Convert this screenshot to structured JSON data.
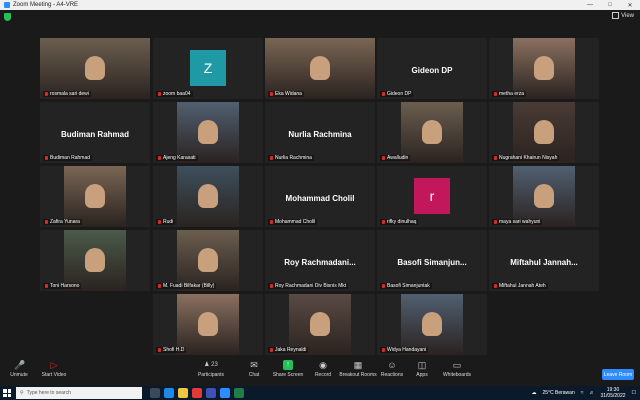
{
  "window": {
    "title": "Zoom Meeting - A4-VRE",
    "view_label": "View"
  },
  "participants": [
    {
      "name": "rosmala sari dewi",
      "kind": "video",
      "active": true
    },
    {
      "name": "zoom baa04",
      "kind": "letter",
      "letter": "Z",
      "color": "#1f9aa5"
    },
    {
      "name": "Eka Widana",
      "kind": "video"
    },
    {
      "name": "Gideon DP",
      "kind": "label",
      "big": "Gideon DP"
    },
    {
      "name": "metha erza",
      "kind": "video"
    },
    {
      "name": "Budiman Rahmad",
      "kind": "label",
      "big": "Budiman Rahmad"
    },
    {
      "name": "Ajeng Karasati",
      "kind": "video"
    },
    {
      "name": "Nurlia Rachmina",
      "kind": "label",
      "big": "Nurlia Rachmina"
    },
    {
      "name": "Awalludin",
      "kind": "video"
    },
    {
      "name": "Nugrahani Khairun Nisyah",
      "kind": "video"
    },
    {
      "name": "Zafira Yunara",
      "kind": "video"
    },
    {
      "name": "Rudi",
      "kind": "video"
    },
    {
      "name": "Mohammad Cholil",
      "kind": "label",
      "big": "Mohammad Cholil"
    },
    {
      "name": "rifky dinulhaq",
      "kind": "letter",
      "letter": "r",
      "color": "#c2185b"
    },
    {
      "name": "maya sari wahyuni",
      "kind": "video"
    },
    {
      "name": "Toni Harsono",
      "kind": "video"
    },
    {
      "name": "M. Fuadi Bilfakar (Billy)",
      "kind": "video"
    },
    {
      "name": "Roy Rachmadani Div Bisnis Mkt",
      "kind": "label",
      "big": "Roy  Rachmadani..."
    },
    {
      "name": "Basofi Simanjuntak",
      "kind": "label",
      "big": "Basofi  Simanjun..."
    },
    {
      "name": "Miftahul Jannah Ateh",
      "kind": "label",
      "big": "Miftahul  Jannah..."
    },
    {
      "name": "Shofi H.D",
      "kind": "video"
    },
    {
      "name": "Jaka Reynaldi",
      "kind": "video"
    },
    {
      "name": "Widya Handayani",
      "kind": "video"
    }
  ],
  "toolbar": {
    "unmute": "Unmute",
    "start_video": "Start Video",
    "participants": "Participants",
    "participants_count": "23",
    "chat": "Chat",
    "share": "Share Screen",
    "record": "Record",
    "breakout": "Breakout Rooms",
    "reactions": "Reactions",
    "apps": "Apps",
    "whiteboards": "Whiteboards",
    "leave": "Leave Room"
  },
  "taskbar": {
    "search_placeholder": "Type here to search",
    "weather": "25°C  Berawan",
    "time": "19:30",
    "date": "31/05/2022"
  }
}
